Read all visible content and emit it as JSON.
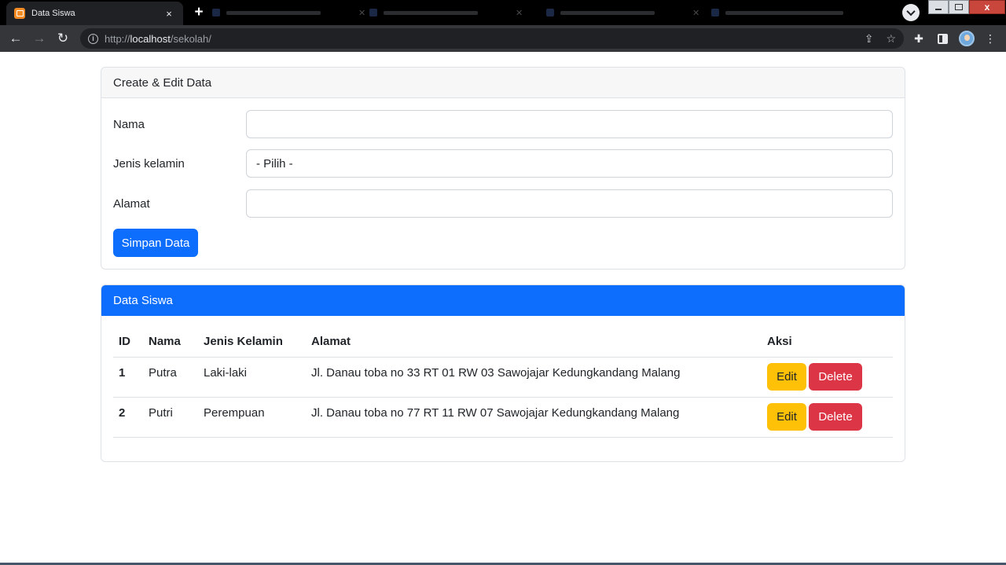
{
  "browser": {
    "active_tab_title": "Data Siswa",
    "tab_close": "×",
    "new_tab": "+",
    "url_host": "localhost",
    "url_prefix": "http://",
    "url_path": "/sekolah/",
    "window_close": "x"
  },
  "form_card": {
    "header": "Create & Edit Data",
    "fields": [
      {
        "label": "Nama",
        "value": "",
        "placeholder": ""
      },
      {
        "label": "Jenis kelamin",
        "value": "- Pilih -"
      },
      {
        "label": "Alamat",
        "value": "",
        "placeholder": ""
      }
    ],
    "submit_label": "Simpan Data"
  },
  "table_card": {
    "header": "Data Siswa",
    "columns": [
      "ID",
      "Nama",
      "Jenis Kelamin",
      "Alamat",
      "Aksi"
    ],
    "rows": [
      {
        "id": "1",
        "nama": "Putra",
        "jenis_kelamin": "Laki-laki",
        "alamat": "Jl. Danau toba no 33 RT 01 RW 03 Sawojajar Kedungkandang Malang"
      },
      {
        "id": "2",
        "nama": "Putri",
        "jenis_kelamin": "Perempuan",
        "alamat": "Jl. Danau toba no 77 RT 11 RW 07 Sawojajar Kedungkandang Malang"
      }
    ],
    "edit_label": "Edit",
    "delete_label": "Delete"
  },
  "colors": {
    "primary": "#0d6efd",
    "warning": "#ffc107",
    "danger": "#dc3545"
  }
}
